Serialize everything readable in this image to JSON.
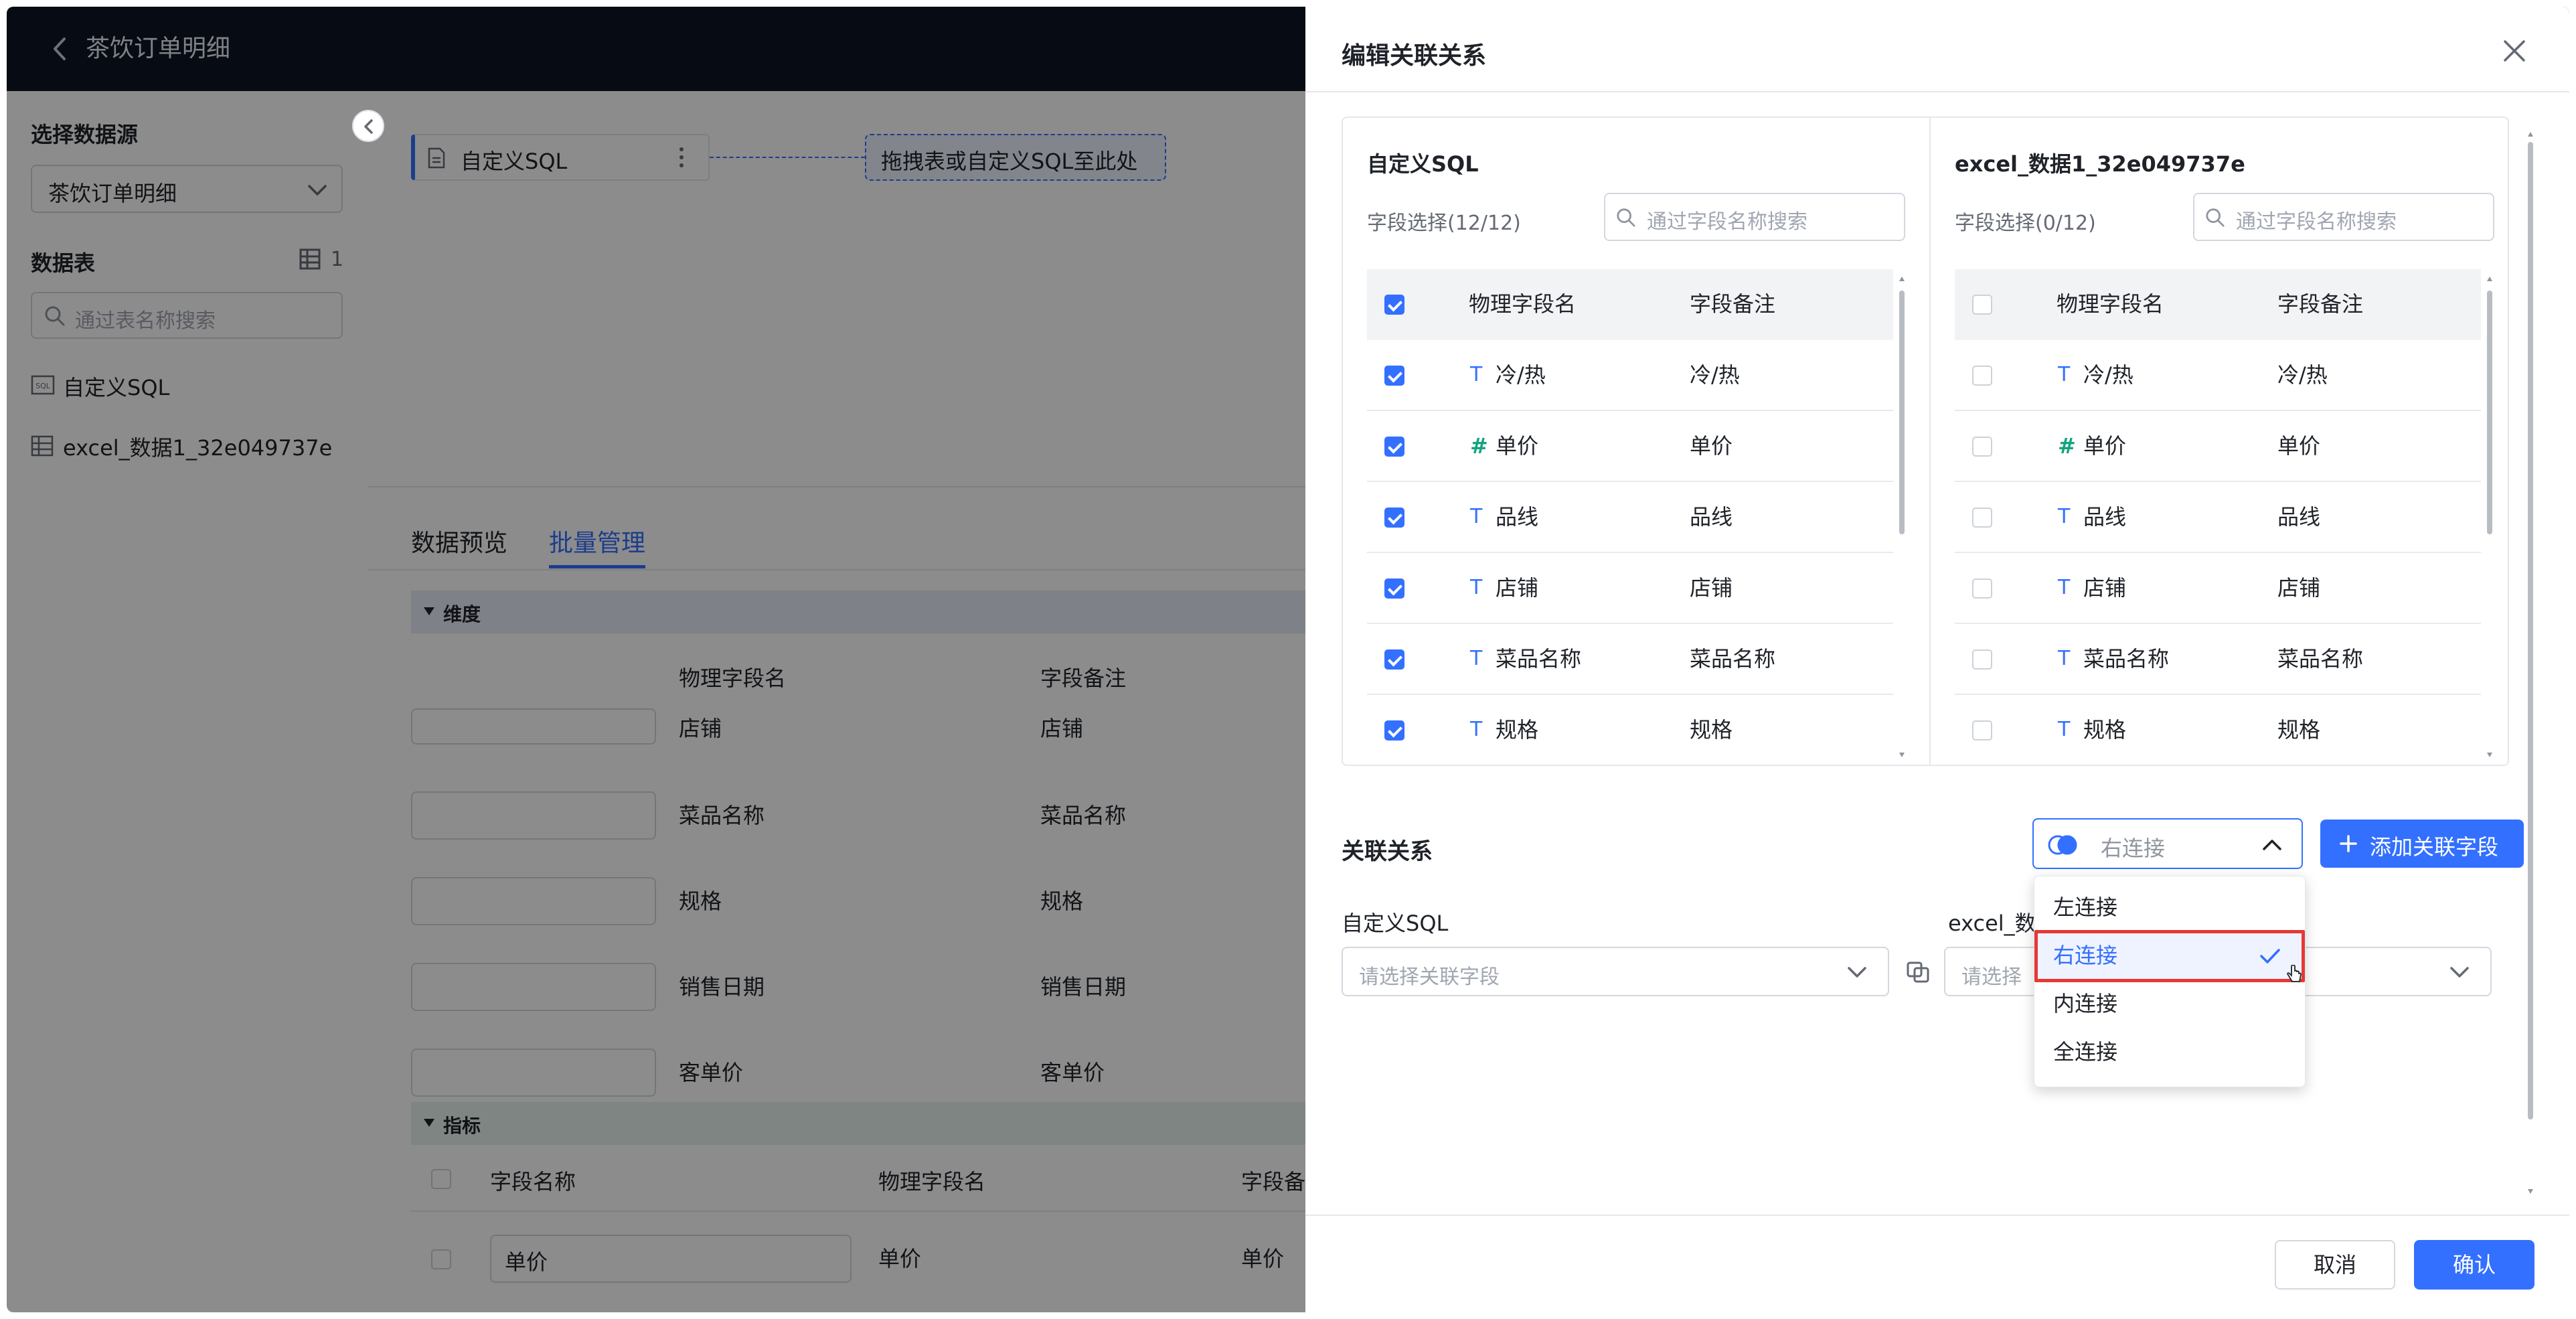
{
  "header": {
    "title": "茶饮订单明细"
  },
  "left_panel": {
    "datasource_label": "选择数据源",
    "datasource_value": "茶饮订单明细",
    "tables_label": "数据表",
    "tables_count": "1",
    "table_search_placeholder": "通过表名称搜索",
    "tables": [
      {
        "name": "自定义SQL",
        "icon": "sql-icon"
      },
      {
        "name": "excel_数据1_32e049737e",
        "icon": "table-icon"
      }
    ]
  },
  "canvas": {
    "node_label": "自定义SQL",
    "drop_hint": "拖拽表或自定义SQL至此处"
  },
  "bottom": {
    "tabs": [
      {
        "label": "数据预览"
      },
      {
        "label": "批量管理",
        "active": true
      }
    ],
    "dimension_section": "维度",
    "dimension_columns": [
      "物理字段名",
      "字段备注"
    ],
    "dimension_rows": [
      {
        "physical": "店铺",
        "remark": "店铺"
      },
      {
        "physical": "菜品名称",
        "remark": "菜品名称"
      },
      {
        "physical": "规格",
        "remark": "规格"
      },
      {
        "physical": "销售日期",
        "remark": "销售日期"
      },
      {
        "physical": "客单价",
        "remark": "客单价"
      }
    ],
    "metric_section": "指标",
    "metric_columns": [
      "字段名称",
      "物理字段名",
      "字段备注"
    ],
    "metric_rows": [
      {
        "name": "单价",
        "physical": "单价",
        "remark": "单价"
      }
    ]
  },
  "drawer": {
    "title": "编辑关联关系",
    "left_table": {
      "title": "自定义SQL",
      "field_select": "字段选择(12/12)",
      "search_placeholder": "通过字段名称搜索",
      "col_physical": "物理字段名",
      "col_remark": "字段备注",
      "rows": [
        {
          "type": "T",
          "name": "冷/热",
          "remark": "冷/热",
          "checked": true
        },
        {
          "type": "#",
          "name": "单价",
          "remark": "单价",
          "checked": true
        },
        {
          "type": "T",
          "name": "品线",
          "remark": "品线",
          "checked": true
        },
        {
          "type": "T",
          "name": "店铺",
          "remark": "店铺",
          "checked": true
        },
        {
          "type": "T",
          "name": "菜品名称",
          "remark": "菜品名称",
          "checked": true
        },
        {
          "type": "T",
          "name": "规格",
          "remark": "规格",
          "checked": true
        }
      ]
    },
    "right_table": {
      "title": "excel_数据1_32e049737e",
      "field_select": "字段选择(0/12)",
      "search_placeholder": "通过字段名称搜索",
      "col_physical": "物理字段名",
      "col_remark": "字段备注",
      "rows": [
        {
          "type": "T",
          "name": "冷/热",
          "remark": "冷/热",
          "checked": false
        },
        {
          "type": "#",
          "name": "单价",
          "remark": "单价",
          "checked": false
        },
        {
          "type": "T",
          "name": "品线",
          "remark": "品线",
          "checked": false
        },
        {
          "type": "T",
          "name": "店铺",
          "remark": "店铺",
          "checked": false
        },
        {
          "type": "T",
          "name": "菜品名称",
          "remark": "菜品名称",
          "checked": false
        },
        {
          "type": "T",
          "name": "规格",
          "remark": "规格",
          "checked": false
        }
      ]
    },
    "relation": {
      "label": "关联关系",
      "join_value": "右连接",
      "add_button": "添加关联字段",
      "left_source": "自定义SQL",
      "right_source": "excel_数",
      "left_placeholder": "请选择关联字段",
      "right_placeholder": "请选择",
      "join_options": [
        {
          "label": "左连接",
          "selected": false
        },
        {
          "label": "右连接",
          "selected": true
        },
        {
          "label": "内连接",
          "selected": false
        },
        {
          "label": "全连接",
          "selected": false
        }
      ]
    },
    "footer": {
      "cancel": "取消",
      "confirm": "确认"
    }
  },
  "colors": {
    "accent": "#3370ff",
    "topbar": "#0e1424",
    "highlight_border": "#e53935"
  }
}
